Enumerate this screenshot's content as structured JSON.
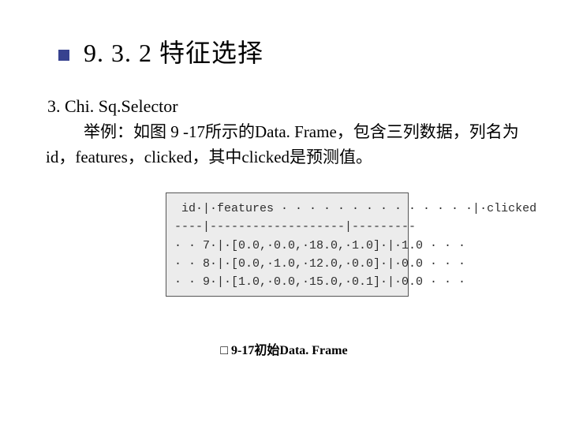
{
  "heading": "9. 3. 2  特征选择",
  "subheading": "3. Chi. Sq.Selector",
  "body_line": "举例：如图 9 -17所示的Data. Frame，包含三列数据，列名为id，features，clicked，其中clicked是预测值。",
  "table": {
    "header": " id·|·features · · · · · · · · · · · · · ·|·clicked",
    "divider": "----|-------------------|---------",
    "rows": [
      "· · 7·|·[0.0,·0.0,·18.0,·1.0]·|·1.0 · · ·",
      "· · 8·|·[0.0,·1.0,·12.0,·0.0]·|·0.0 · · ·",
      "· · 9·|·[1.0,·0.0,·15.0,·0.1]·|·0.0 · · ·"
    ]
  },
  "caption_prefix": "□ 9‑17 ",
  "caption_text": "初始Data. Frame",
  "chart_data": {
    "type": "table",
    "title": "初始Data.Frame (图 9-17)",
    "columns": [
      "id",
      "features",
      "clicked"
    ],
    "rows": [
      {
        "id": 7,
        "features": [
          0.0,
          0.0,
          18.0,
          1.0
        ],
        "clicked": 1.0
      },
      {
        "id": 8,
        "features": [
          0.0,
          1.0,
          12.0,
          0.0
        ],
        "clicked": 0.0
      },
      {
        "id": 9,
        "features": [
          1.0,
          0.0,
          15.0,
          0.1
        ],
        "clicked": 0.0
      }
    ]
  }
}
